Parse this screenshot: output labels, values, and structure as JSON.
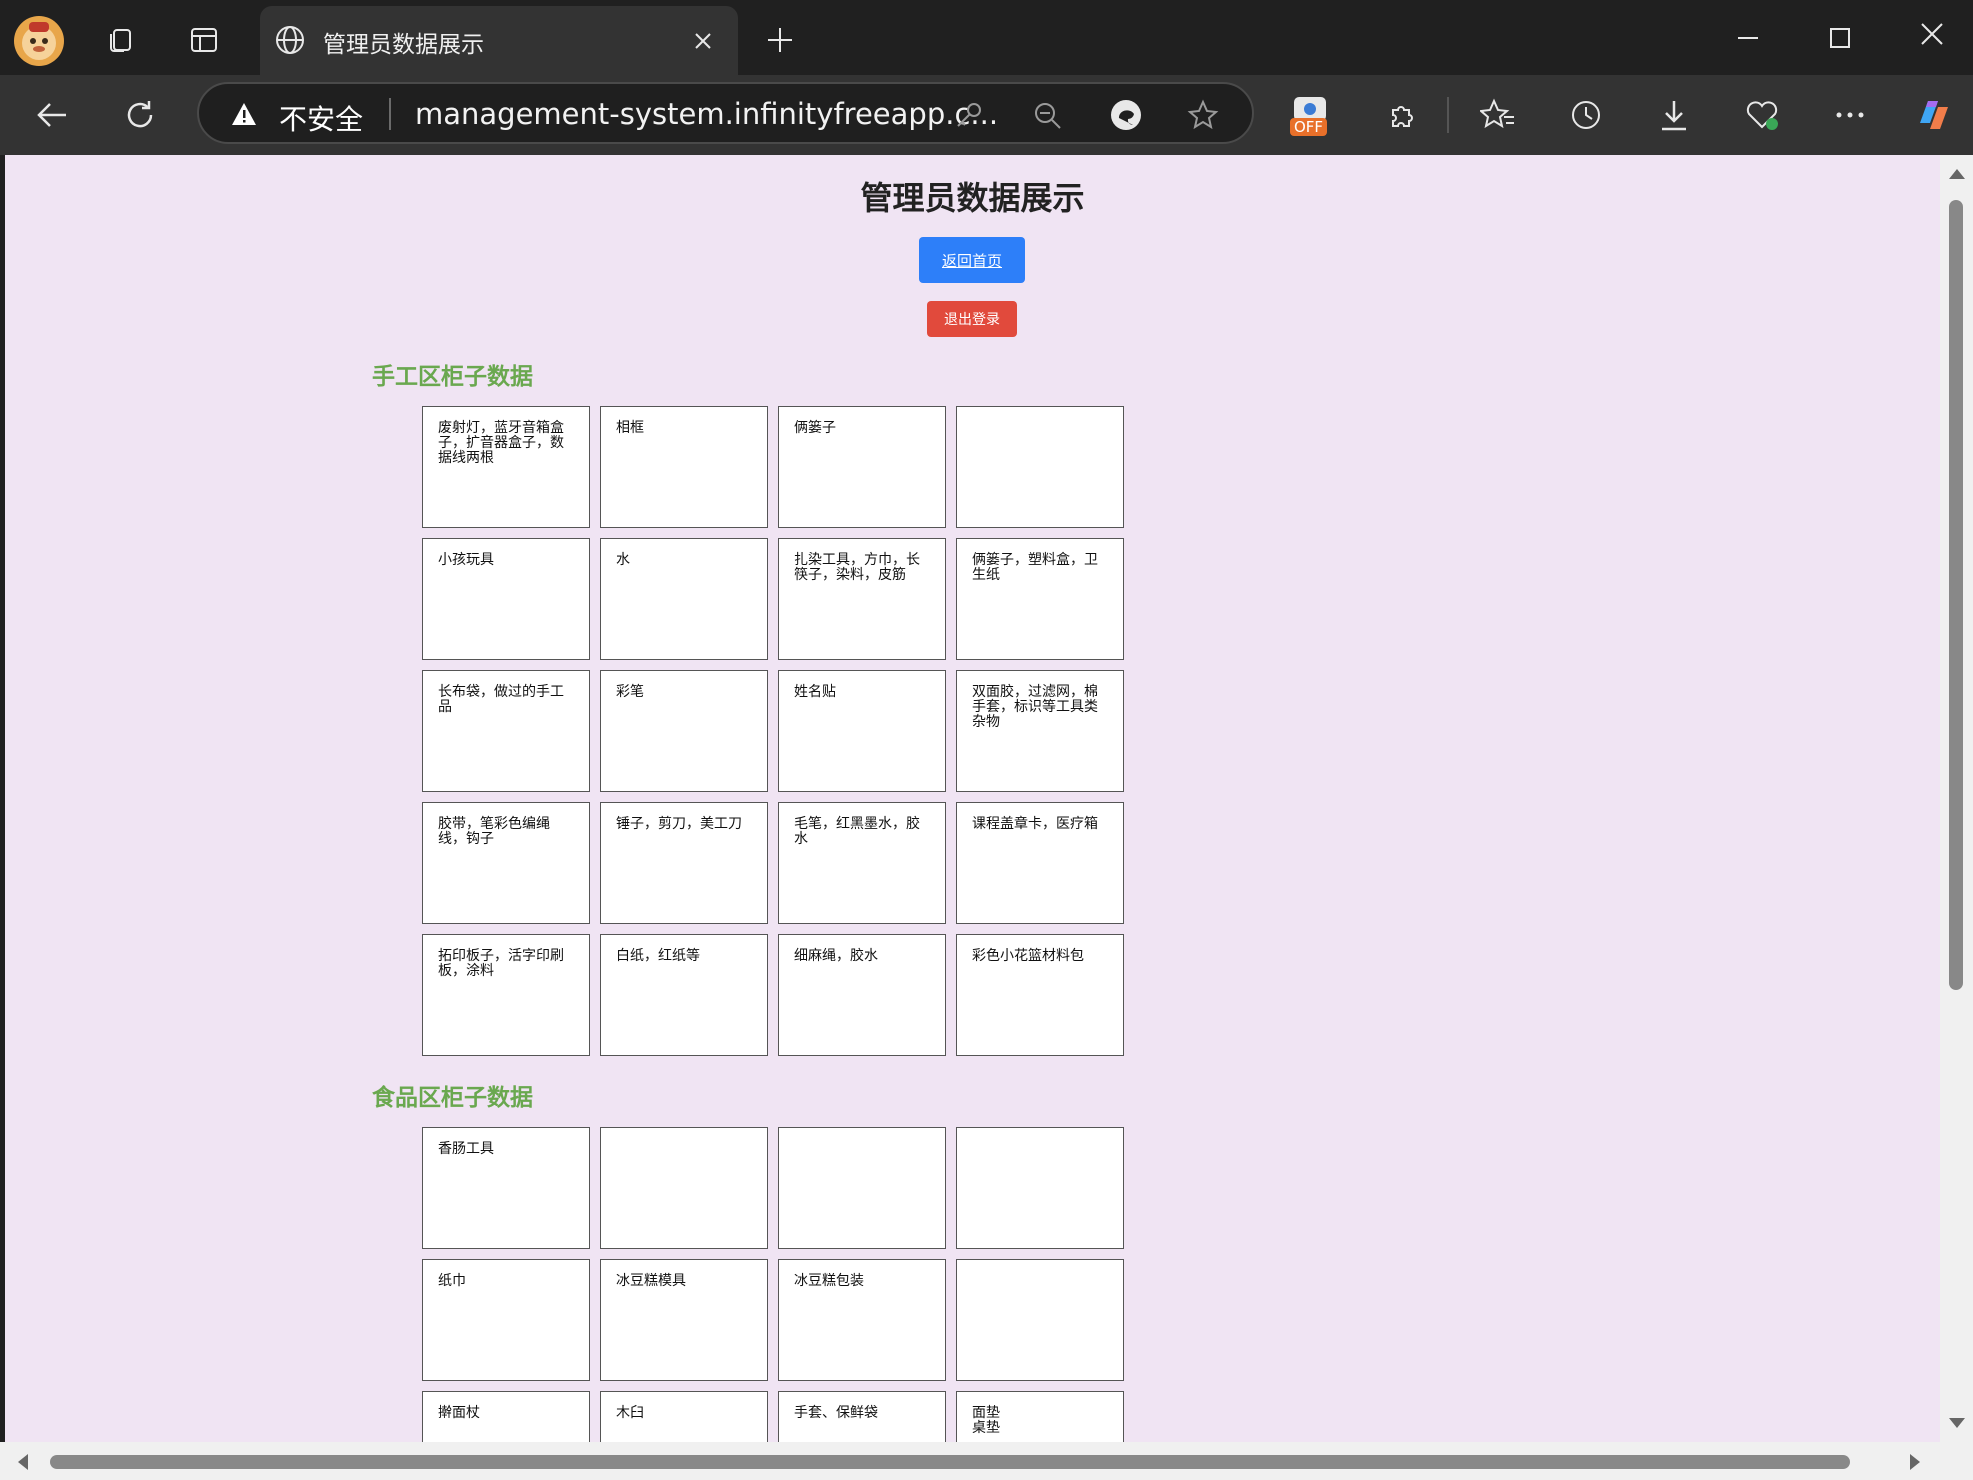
{
  "tab": {
    "title": "管理员数据展示"
  },
  "address_bar": {
    "security_label": "不安全",
    "url": "management-system.infinityfreeapp.c..."
  },
  "extension_badge": "OFF",
  "page": {
    "title": "管理员数据展示",
    "home_button": "返回首页",
    "logout_button": "退出登录",
    "sections": [
      {
        "title": "手工区柜子数据",
        "cells": [
          "废射灯，蓝牙音箱盒子，扩音器盒子，数据线两根",
          "相框",
          "俩篓子",
          "",
          "小孩玩具",
          "水",
          "扎染工具，方巾，长筷子，染料，皮筋",
          "俩篓子，塑料盒，卫生纸",
          "长布袋，做过的手工品",
          "彩笔",
          "姓名贴",
          "双面胶，过滤网，棉手套，标识等工具类杂物",
          "胶带，笔彩色编绳线，钩子",
          "锤子，剪刀，美工刀",
          "毛笔，红黑墨水，胶水",
          "课程盖章卡，医疗箱",
          "拓印板子，活字印刷板，涂料",
          "白纸，红纸等",
          "细麻绳，胶水",
          "彩色小花篮材料包"
        ]
      },
      {
        "title": "食品区柜子数据",
        "cells": [
          "香肠工具",
          "",
          "",
          "",
          "纸巾",
          "冰豆糕模具",
          "冰豆糕包装",
          "",
          "擀面杖",
          "木臼",
          "手套、保鲜袋",
          "面垫\n桌垫"
        ]
      }
    ]
  }
}
